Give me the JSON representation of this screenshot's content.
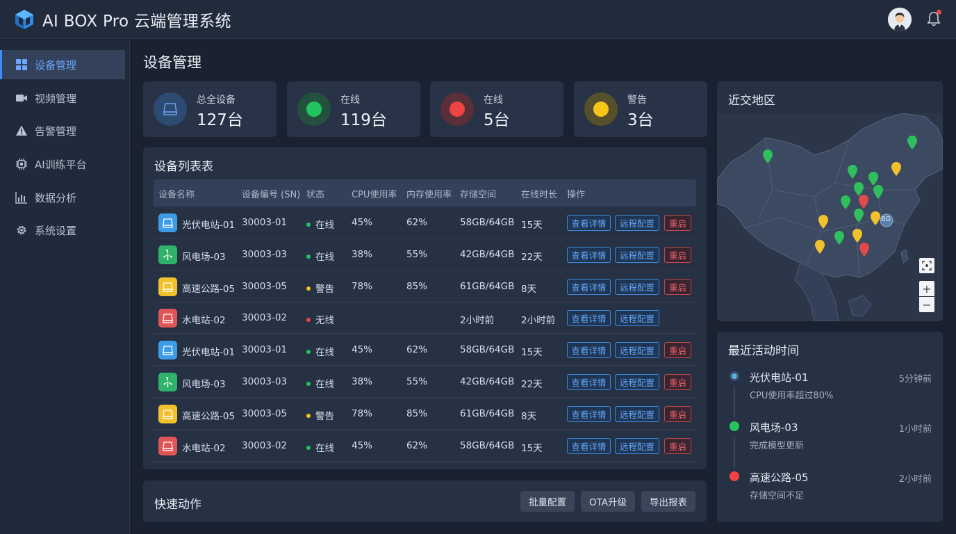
{
  "header": {
    "title": "AI BOX Pro 云端管理系统"
  },
  "sidebar": {
    "items": [
      {
        "label": "设备管理",
        "icon": "grid-icon",
        "active": true
      },
      {
        "label": "视频管理",
        "icon": "video-icon",
        "active": false
      },
      {
        "label": "告警管理",
        "icon": "warning-icon",
        "active": false
      },
      {
        "label": "AI训练平台",
        "icon": "chip-icon",
        "active": false
      },
      {
        "label": "数据分析",
        "icon": "bar-chart-icon",
        "active": false
      },
      {
        "label": "系统设置",
        "icon": "gear-icon",
        "active": false
      }
    ]
  },
  "main": {
    "title": "设备管理",
    "stats": [
      {
        "label": "总全设备",
        "value": "127台",
        "color": "#4a7fd6"
      },
      {
        "label": "在线",
        "value": "119台",
        "color": "#22c55e"
      },
      {
        "label": "在线",
        "value": "5台",
        "color": "#ef4444"
      },
      {
        "label": "警告",
        "value": "3台",
        "color": "#f5c518"
      }
    ],
    "table": {
      "title": "设备列表表",
      "headers": [
        "设备名称",
        "设备编号 (SN)",
        "状态",
        "CPU使用率",
        "内存使用率",
        "存储空间",
        "在线时长",
        "操作"
      ],
      "rows": [
        {
          "name": "光伏电站-01",
          "sn": "30003-01",
          "status": "在线",
          "cpu": "45%",
          "mem": "62%",
          "storage": "58GB/64GB",
          "uptime": "15天",
          "type": "solar"
        },
        {
          "name": "风电场-03",
          "sn": "30003-03",
          "status": "在线",
          "cpu": "38%",
          "mem": "55%",
          "storage": "42GB/64GB",
          "uptime": "22天",
          "type": "wind"
        },
        {
          "name": "高速公路-05",
          "sn": "30003-05",
          "status": "警告",
          "cpu": "78%",
          "mem": "85%",
          "storage": "61GB/64GB",
          "uptime": "8天",
          "type": "road"
        },
        {
          "name": "水电站-02",
          "sn": "30003-02",
          "status": "无线",
          "cpu": "",
          "mem": "",
          "storage": "2小时前",
          "uptime": "2小时前",
          "type": "hydro"
        },
        {
          "name": "光伏电站-01",
          "sn": "30003-01",
          "status": "在线",
          "cpu": "45%",
          "mem": "62%",
          "storage": "58GB/64GB",
          "uptime": "15天",
          "type": "solar"
        },
        {
          "name": "风电场-03",
          "sn": "30003-03",
          "status": "在线",
          "cpu": "38%",
          "mem": "55%",
          "storage": "42GB/64GB",
          "uptime": "22天",
          "type": "wind"
        },
        {
          "name": "高速公路-05",
          "sn": "30003-05",
          "status": "警告",
          "cpu": "78%",
          "mem": "85%",
          "storage": "61GB/64GB",
          "uptime": "8天",
          "type": "road"
        },
        {
          "name": "水电站-02",
          "sn": "30003-02",
          "status": "在线",
          "cpu": "45%",
          "mem": "62%",
          "storage": "58GB/64GB",
          "uptime": "15天",
          "type": "hydro"
        }
      ],
      "actions": {
        "view": "查看详情",
        "remote": "远程配置",
        "restart": "重启"
      }
    },
    "quick_actions": {
      "title": "快速动作",
      "buttons": [
        "批量配置",
        "OTA升级",
        "导出报表"
      ]
    }
  },
  "map": {
    "title": "近交地区",
    "badge": "8G",
    "zoom_in": "+",
    "zoom_out": "−"
  },
  "activity": {
    "title": "最近活动时间",
    "items": [
      {
        "name": "光伏电站-01",
        "desc": "CPU使用率超过80%",
        "time": "5分钟前",
        "color": "#5fb4e6"
      },
      {
        "name": "风电场-03",
        "desc": "完成模型更新",
        "time": "1小时前",
        "color": "#22c55e"
      },
      {
        "name": "高速公路-05",
        "desc": "存储空间不足",
        "time": "2小时前",
        "color": "#ef4444"
      }
    ]
  },
  "colors": {
    "accent": "#3f8cff",
    "online": "#22c55e",
    "warning": "#f5c518",
    "offline": "#ef4444",
    "solar": "#3d9be8",
    "wind": "#2fb36b",
    "road": "#f2c12e",
    "hydro": "#e05656"
  }
}
